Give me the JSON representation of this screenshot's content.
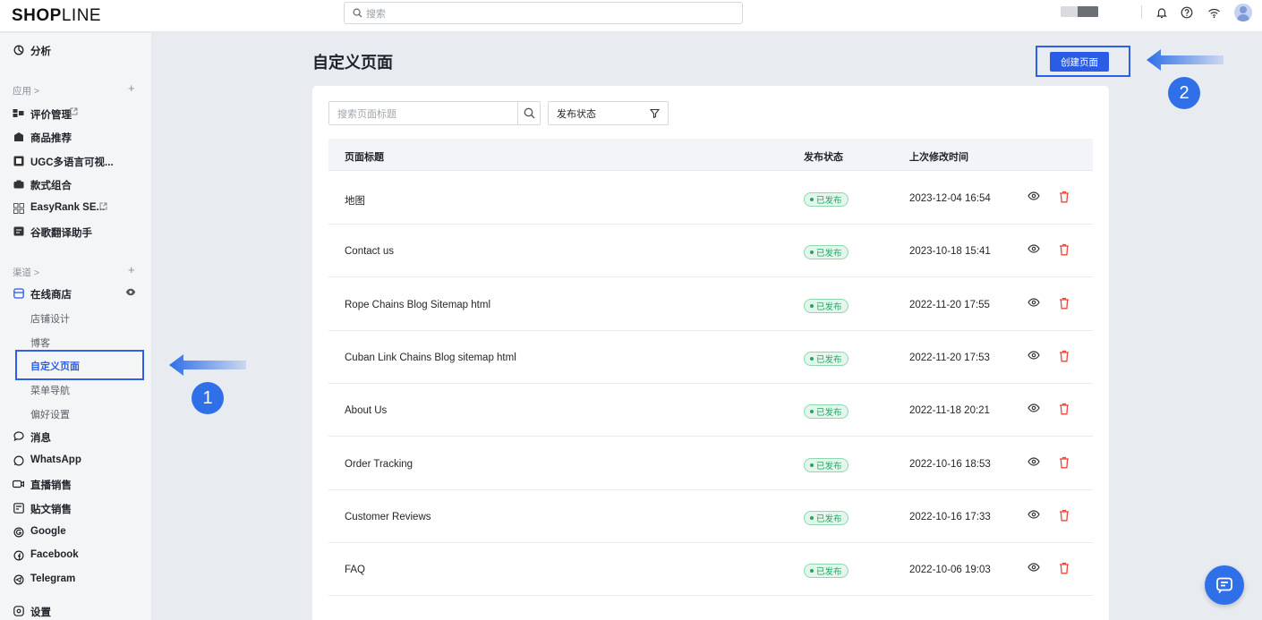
{
  "topbar": {
    "logo_bold": "SHOP",
    "logo_thin": "LINE",
    "search_placeholder": "搜索"
  },
  "sidebar": {
    "analytics": "分析",
    "apps_section": "应用 >",
    "apps": [
      {
        "label": "评价管理",
        "icon": "reviews-icon",
        "external": true
      },
      {
        "label": "商品推荐",
        "icon": "recommend-icon",
        "external": false
      },
      {
        "label": "UGC多语言可视...",
        "icon": "ugc-icon",
        "external": false
      },
      {
        "label": "款式组合",
        "icon": "bundle-icon",
        "external": false
      },
      {
        "label": "EasyRank SE...",
        "icon": "seo-icon",
        "external": true
      },
      {
        "label": "谷歌翻译助手",
        "icon": "translate-icon",
        "external": false
      }
    ],
    "channels_section": "渠道 >",
    "online_store": "在线商店",
    "online_store_subs": [
      "店铺设计",
      "博客",
      "自定义页面",
      "菜单导航",
      "偏好设置"
    ],
    "active_sub": "自定义页面",
    "channels": [
      {
        "label": "消息",
        "icon": "message-icon"
      },
      {
        "label": "WhatsApp",
        "icon": "whatsapp-icon"
      },
      {
        "label": "直播销售",
        "icon": "live-icon"
      },
      {
        "label": "贴文销售",
        "icon": "post-icon"
      },
      {
        "label": "Google",
        "icon": "google-icon"
      },
      {
        "label": "Facebook",
        "icon": "facebook-icon"
      },
      {
        "label": "Telegram",
        "icon": "telegram-icon"
      }
    ],
    "settings": "设置"
  },
  "main": {
    "title": "自定义页面",
    "create_button": "创建页面",
    "search_placeholder": "搜索页面标题",
    "status_filter": "发布状态",
    "columns": {
      "title": "页面标题",
      "status": "发布状态",
      "modified": "上次修改时间"
    },
    "rows": [
      {
        "title": "地图",
        "status": "已发布",
        "modified": "2023-12-04 16:54"
      },
      {
        "title": "Contact us",
        "status": "已发布",
        "modified": "2023-10-18 15:41"
      },
      {
        "title": "Rope Chains Blog Sitemap html",
        "status": "已发布",
        "modified": "2022-11-20 17:55"
      },
      {
        "title": "Cuban Link Chains Blog sitemap html",
        "status": "已发布",
        "modified": "2022-11-20 17:53"
      },
      {
        "title": "About Us",
        "status": "已发布",
        "modified": "2022-11-18 20:21"
      },
      {
        "title": "Order Tracking",
        "status": "已发布",
        "modified": "2022-10-16 18:53"
      },
      {
        "title": "Customer Reviews",
        "status": "已发布",
        "modified": "2022-10-16 17:33"
      },
      {
        "title": "FAQ",
        "status": "已发布",
        "modified": "2022-10-06 19:03"
      }
    ]
  },
  "annotations": {
    "step1": "1",
    "step2": "2"
  },
  "colors": {
    "accent": "#2b5ce6",
    "published_green": "#23a565",
    "delete_red": "#f04438"
  }
}
